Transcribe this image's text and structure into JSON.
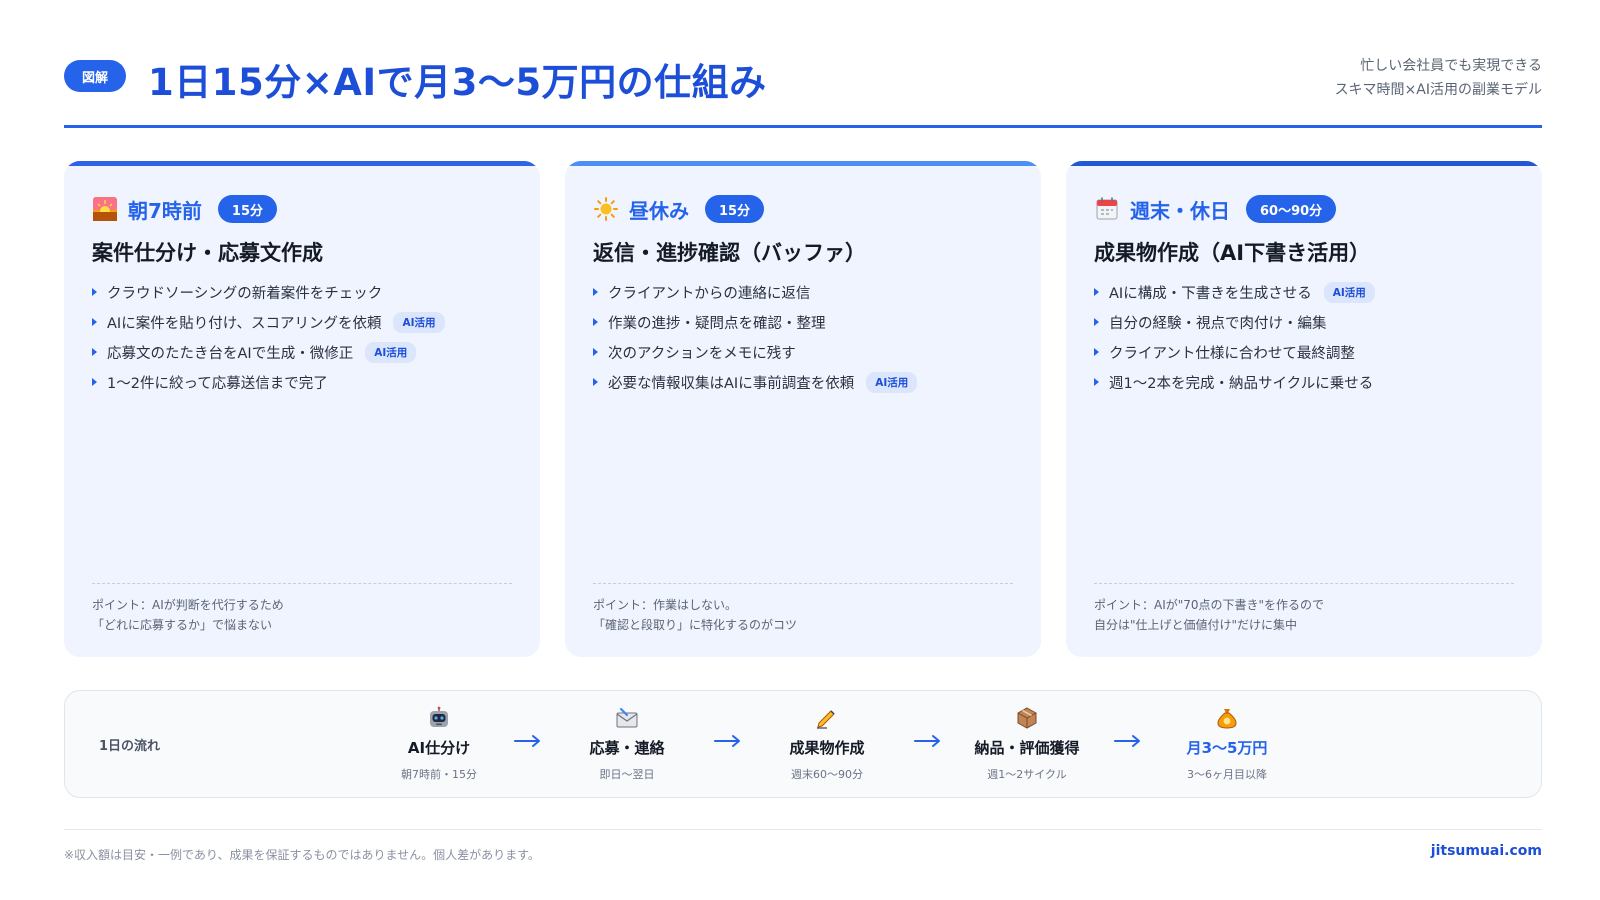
{
  "header": {
    "badge": "図解",
    "title": "1日15分×AIで月3〜5万円の仕組み",
    "subtitle_line1": "忙しい会社員でも実現できる",
    "subtitle_line2": "スキマ時間×AI活用の副業モデル"
  },
  "cards": [
    {
      "icon": "sunrise-icon",
      "time": "朝7時前",
      "duration": "15分",
      "title": "案件仕分け・応募文作成",
      "items": [
        {
          "text": "クラウドソーシングの新着案件をチェック",
          "tag": ""
        },
        {
          "text": "AIに案件を貼り付け、スコアリングを依頼",
          "tag": "AI活用"
        },
        {
          "text": "応募文のたたき台をAIで生成・微修正",
          "tag": "AI活用"
        },
        {
          "text": "1〜2件に絞って応募送信まで完了",
          "tag": ""
        }
      ],
      "note_line1": "ポイント：AIが判断を代行するため",
      "note_line2": "「どれに応募するか」で悩まない"
    },
    {
      "icon": "sun-icon",
      "time": "昼休み",
      "duration": "15分",
      "title": "返信・進捗確認（バッファ）",
      "items": [
        {
          "text": "クライアントからの連絡に返信",
          "tag": ""
        },
        {
          "text": "作業の進捗・疑問点を確認・整理",
          "tag": ""
        },
        {
          "text": "次のアクションをメモに残す",
          "tag": ""
        },
        {
          "text": "必要な情報収集はAIに事前調査を依頼",
          "tag": "AI活用"
        }
      ],
      "note_line1": "ポイント：作業はしない。",
      "note_line2": "「確認と段取り」に特化するのがコツ"
    },
    {
      "icon": "calendar-icon",
      "time": "週末・休日",
      "duration": "60〜90分",
      "title": "成果物作成（AI下書き活用）",
      "items": [
        {
          "text": "AIに構成・下書きを生成させる",
          "tag": "AI活用"
        },
        {
          "text": "自分の経験・視点で肉付け・編集",
          "tag": ""
        },
        {
          "text": "クライアント仕様に合わせて最終調整",
          "tag": ""
        },
        {
          "text": "週1〜2本を完成・納品サイクルに乗せる",
          "tag": ""
        }
      ],
      "note_line1": "ポイント：AIが\"70点の下書き\"を作るので",
      "note_line2": "自分は\"仕上げと価値付け\"だけに集中"
    }
  ],
  "flow": {
    "label": "1日の流れ",
    "steps": [
      {
        "icon": "robot-icon",
        "label": "AI仕分け",
        "sub": "朝7時前・15分"
      },
      {
        "icon": "mail-icon",
        "label": "応募・連絡",
        "sub": "即日〜翌日"
      },
      {
        "icon": "writing-hand-icon",
        "label": "成果物作成",
        "sub": "週末60〜90分"
      },
      {
        "icon": "package-icon",
        "label": "納品・評価獲得",
        "sub": "週1〜2サイクル"
      },
      {
        "icon": "money-bag-icon",
        "label": "月3〜5万円",
        "sub": "3〜6ヶ月目以降"
      }
    ]
  },
  "footer": {
    "disclaimer": "※収入額は目安・一例であり、成果を保証するものではありません。個人差があります。",
    "site": "jitsumuai.com"
  },
  "colors": {
    "accent": "#2563eb",
    "title": "#1d4ed8",
    "card_bg": "#eff4ff",
    "tag_bg": "#dbe6fd"
  }
}
